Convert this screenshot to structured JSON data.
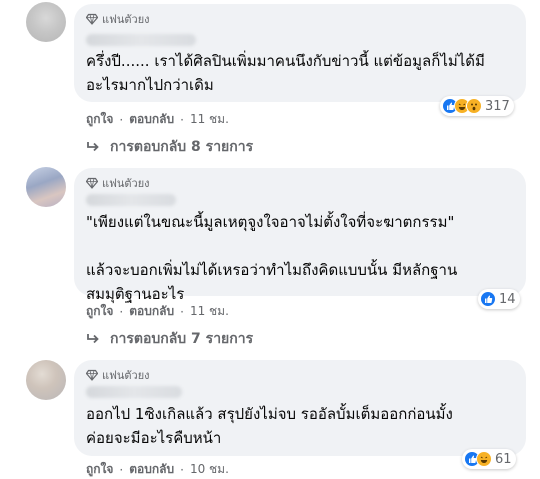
{
  "comments": [
    {
      "badge": "แฟนตัวยง",
      "text": "ครึ่งปี...... เราได้ศิลปินเพิ่มมาคนนึงกับข่าวนี้ แต่ข้อมูลก็ไม่ได้มี\nอะไรมากไปกว่าเดิม",
      "like": "ถูกใจ",
      "reply": "ตอบกลับ",
      "time": "11 ชม.",
      "reaction_count": "317",
      "reactions": [
        "like-icon",
        "haha-icon",
        "wow-icon"
      ],
      "replies_label": "การตอบกลับ 8 รายการ"
    },
    {
      "badge": "แฟนตัวยง",
      "text": "\"เพียงแต่ในขณะนี้มูลเหตุจูงใจอาจไม่ตั้งใจที่จะฆาตกรรม\"\n\nแล้วจะบอกเพิ่มไม่ได้เหรอว่าทำไมถึงคิดแบบนั้น มีหลักฐาน\nสมมุติฐานอะไร",
      "like": "ถูกใจ",
      "reply": "ตอบกลับ",
      "time": "11 ชม.",
      "reaction_count": "14",
      "reactions": [
        "like-icon"
      ],
      "replies_label": "การตอบกลับ 7 รายการ"
    },
    {
      "badge": "แฟนตัวยง",
      "text": "ออกไป 1ซิงเกิลแล้ว สรุปยังไม่จบ รออัลบั้มเต็มออกก่อนมั้ง\nค่อยจะมีอะไรคืบหน้า",
      "like": "ถูกใจ",
      "reply": "ตอบกลับ",
      "time": "10 ชม.",
      "reaction_count": "61",
      "reactions": [
        "like-icon",
        "haha-icon"
      ]
    }
  ],
  "separator": "·",
  "colors": {
    "bubble": "#f0f2f5",
    "meta": "#65676b",
    "like": "#1877f2",
    "haha": "#f7b125"
  }
}
